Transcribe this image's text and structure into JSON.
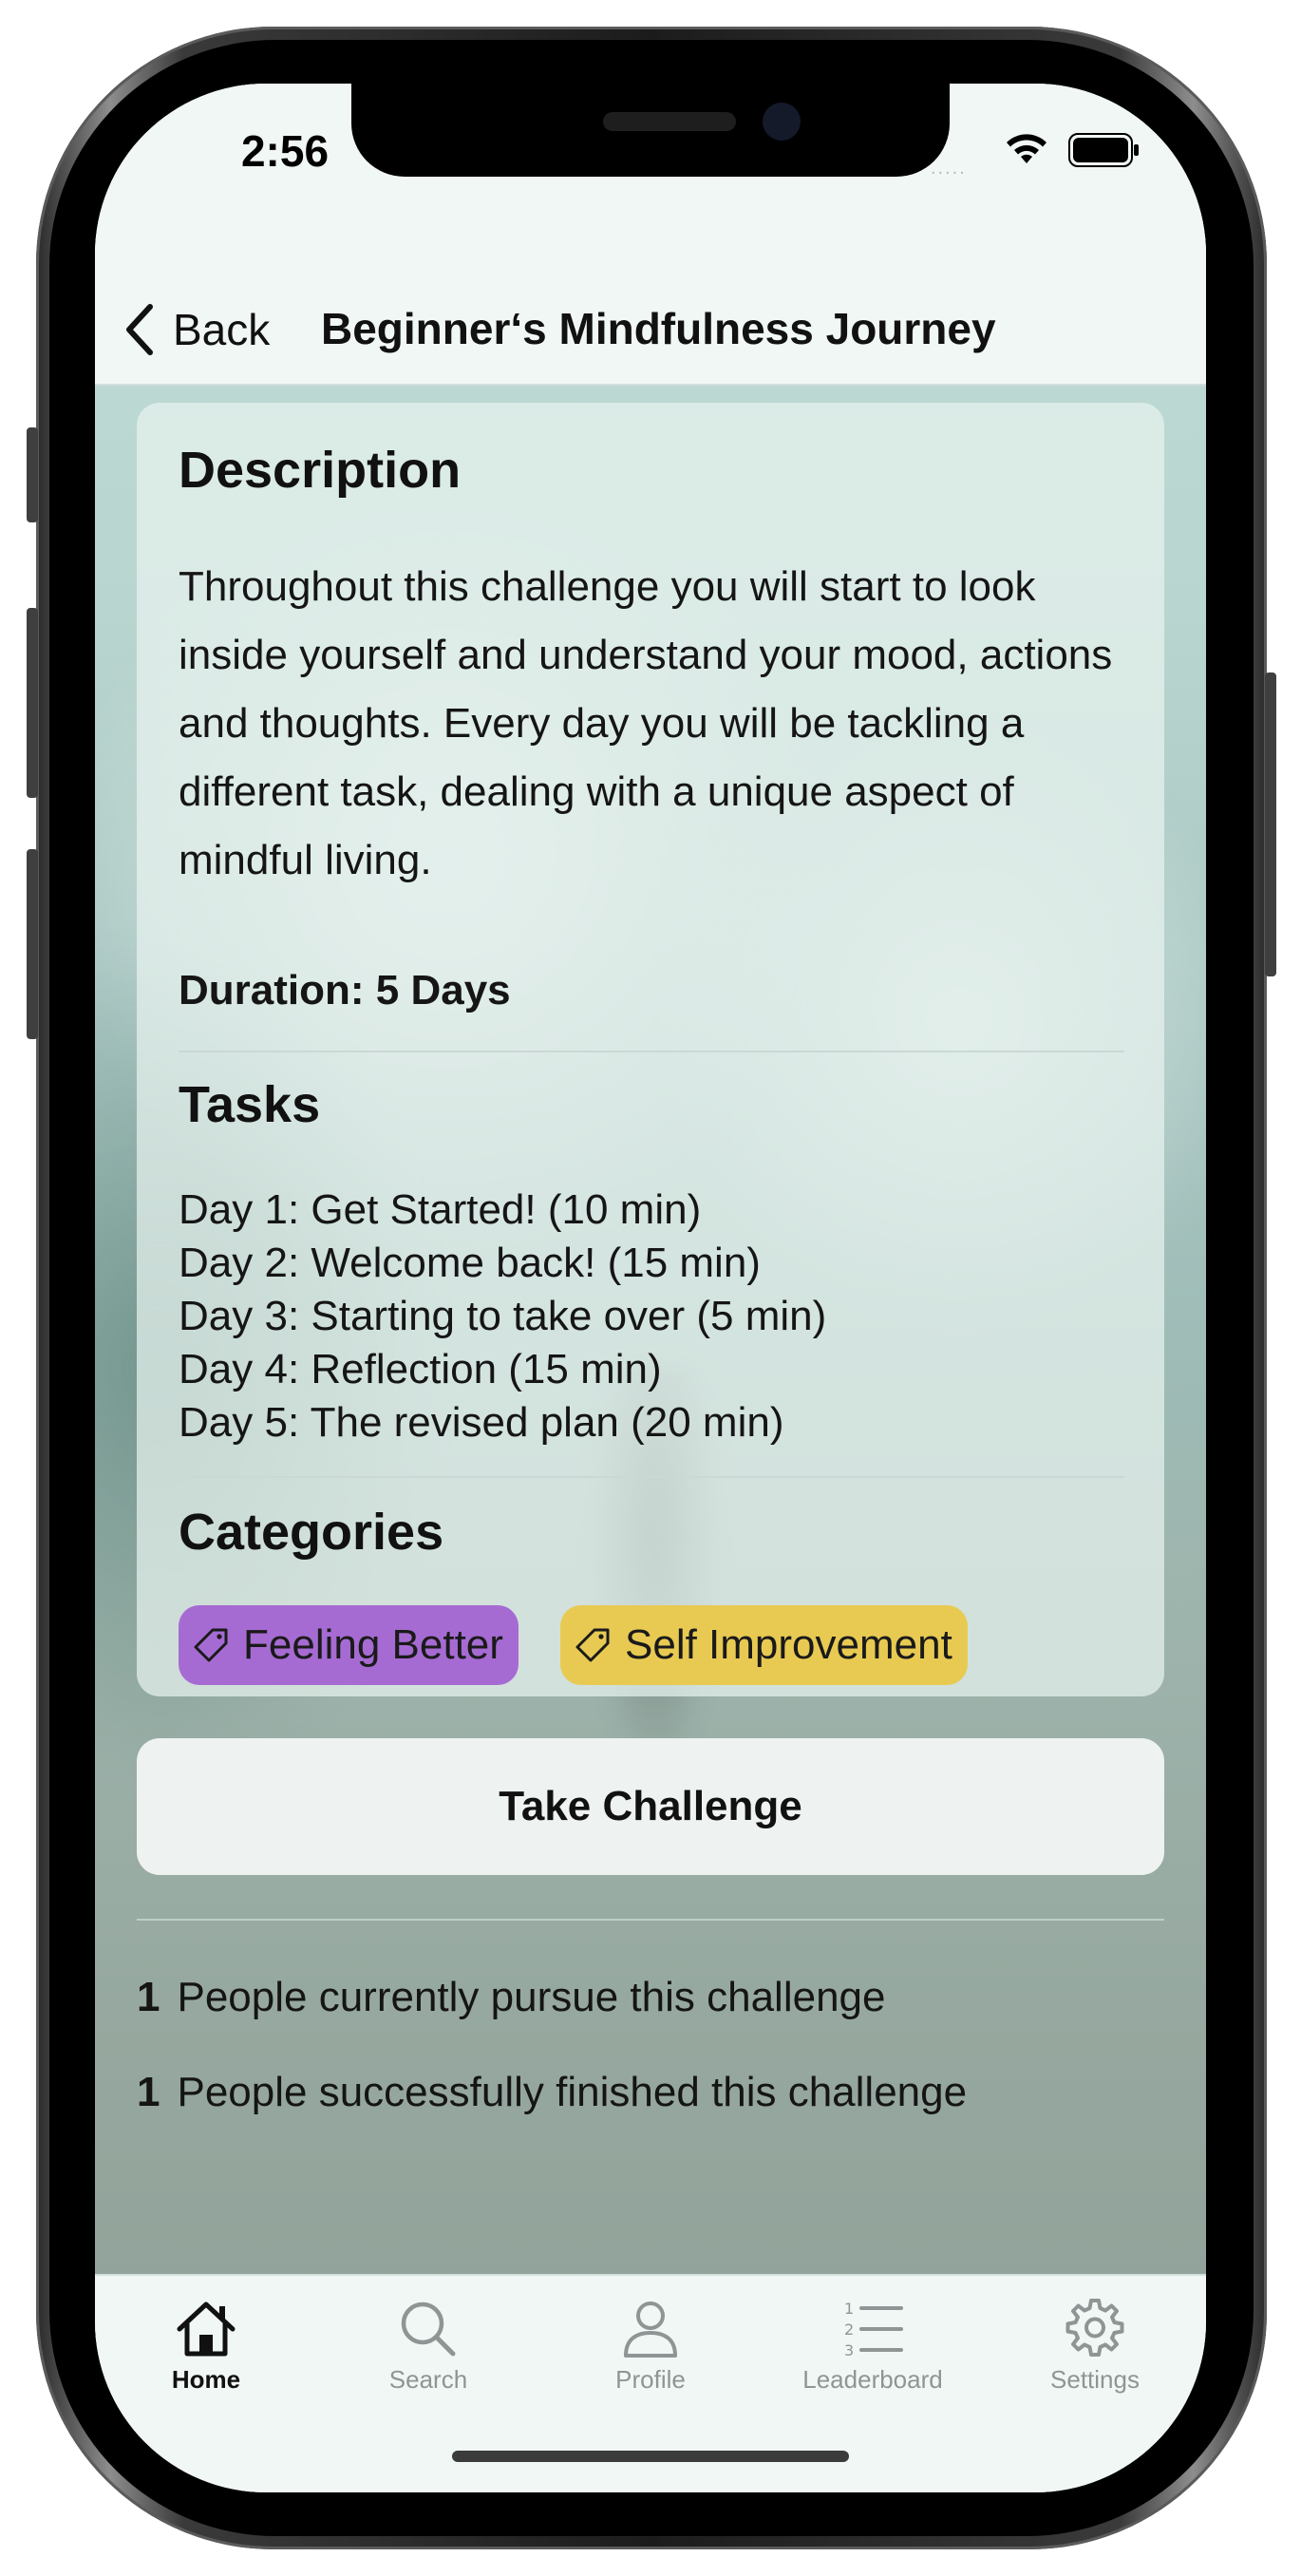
{
  "status": {
    "time": "2:56",
    "dots": "....."
  },
  "nav": {
    "back_label": "Back",
    "title": "Beginner‘s Mindfulness Journey"
  },
  "description": {
    "heading": "Description",
    "text": "Throughout this challenge you will start to look inside yourself and understand your mood, actions and thoughts. Every day you will be tackling a different task, dealing with a unique aspect of mindful living.",
    "duration": "Duration: 5 Days"
  },
  "tasks": {
    "heading": "Tasks",
    "items": [
      "Day 1: Get Started! (10 min)",
      "Day 2: Welcome back! (15 min)",
      "Day 3: Starting to take over (5 min)",
      "Day 4: Reflection (15 min)",
      "Day 5: The revised plan (20 min)"
    ]
  },
  "categories": {
    "heading": "Categories",
    "items": [
      {
        "label": "Feeling Better",
        "color": "#a66bd3"
      },
      {
        "label": "Self Improvement",
        "color": "#e8ca52"
      }
    ]
  },
  "take_button_label": "Take Challenge",
  "stats": {
    "pursuing": {
      "count": "1",
      "label": "People currently pursue this challenge"
    },
    "finished": {
      "count": "1",
      "label": "People successfully finished this challenge"
    }
  },
  "tabbar": {
    "items": [
      {
        "label": "Home",
        "icon": "house-icon",
        "active": true
      },
      {
        "label": "Search",
        "icon": "magnifier-icon",
        "active": false
      },
      {
        "label": "Profile",
        "icon": "person-icon",
        "active": false
      },
      {
        "label": "Leaderboard",
        "icon": "numbered-list-icon",
        "active": false
      },
      {
        "label": "Settings",
        "icon": "gear-icon",
        "active": false
      }
    ]
  }
}
